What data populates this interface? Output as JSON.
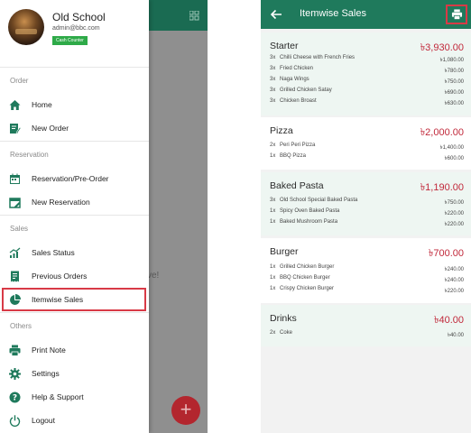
{
  "left_screen": {
    "underlay_text": "ve!",
    "fab_symbol": "+",
    "profile": {
      "name": "Old School",
      "email": "admin@bbc.com",
      "badge": "Cash Counter"
    },
    "sections": [
      {
        "title": "Order",
        "items": [
          {
            "label": "Home",
            "icon": "home-icon"
          },
          {
            "label": "New Order",
            "icon": "edit-note-icon"
          }
        ]
      },
      {
        "title": "Reservation",
        "items": [
          {
            "label": "Reservation/Pre-Order",
            "icon": "calendar-icon"
          },
          {
            "label": "New Reservation",
            "icon": "calendar-edit-icon"
          }
        ]
      },
      {
        "title": "Sales",
        "items": [
          {
            "label": "Sales Status",
            "icon": "trend-chart-icon"
          },
          {
            "label": "Previous Orders",
            "icon": "receipt-icon"
          },
          {
            "label": "Itemwise Sales",
            "icon": "pie-chart-icon",
            "selected": true
          }
        ]
      },
      {
        "title": "Others",
        "items": [
          {
            "label": "Print Note",
            "icon": "printer-icon"
          },
          {
            "label": "Settings",
            "icon": "gear-icon"
          },
          {
            "label": "Help & Support",
            "icon": "help-icon"
          },
          {
            "label": "Logout",
            "icon": "power-icon"
          }
        ]
      }
    ]
  },
  "right_screen": {
    "title": "Itemwise Sales",
    "icons": {
      "back": "arrow-back-icon",
      "print": "printer-icon"
    },
    "categories": [
      {
        "name": "Starter",
        "total": "৳3,930.00",
        "items": [
          {
            "qty": "3x",
            "name": "Chilli Cheese with French Fries",
            "price": "৳1,080.00"
          },
          {
            "qty": "3x",
            "name": "Fried Chicken",
            "price": "৳780.00"
          },
          {
            "qty": "3x",
            "name": "Naga Wings",
            "price": "৳750.00"
          },
          {
            "qty": "3x",
            "name": "Grilled Chicken Satay",
            "price": "৳690.00"
          },
          {
            "qty": "3x",
            "name": "Chicken Broast",
            "price": "৳630.00"
          }
        ]
      },
      {
        "name": "Pizza",
        "total": "৳2,000.00",
        "items": [
          {
            "qty": "2x",
            "name": "Peri Peri Pizza",
            "price": "৳1,400.00"
          },
          {
            "qty": "1x",
            "name": "BBQ Pizza",
            "price": "৳600.00"
          }
        ]
      },
      {
        "name": "Baked Pasta",
        "total": "৳1,190.00",
        "items": [
          {
            "qty": "3x",
            "name": "Old School Special Baked Pasta",
            "price": "৳750.00"
          },
          {
            "qty": "1x",
            "name": "Spicy Oven Baked Pasta",
            "price": "৳220.00"
          },
          {
            "qty": "1x",
            "name": "Baked Mushroom Pasta",
            "price": "৳220.00"
          }
        ]
      },
      {
        "name": "Burger",
        "total": "৳700.00",
        "items": [
          {
            "qty": "1x",
            "name": "Grilled Chicken Burger",
            "price": "৳240.00"
          },
          {
            "qty": "1x",
            "name": "BBQ Chicken Burger",
            "price": "৳240.00"
          },
          {
            "qty": "1x",
            "name": "Crispy Chicken Burger",
            "price": "৳220.00"
          }
        ]
      },
      {
        "name": "Drinks",
        "total": "৳40.00",
        "items": [
          {
            "qty": "2x",
            "name": "Coke",
            "price": "৳40.00"
          }
        ]
      }
    ]
  },
  "colors": {
    "primary_green": "#1f7a5c",
    "accent_red": "#c1283a",
    "highlight_red": "#d83a46",
    "badge_green": "#2eaa48",
    "card_tint": "#eef6f2"
  }
}
